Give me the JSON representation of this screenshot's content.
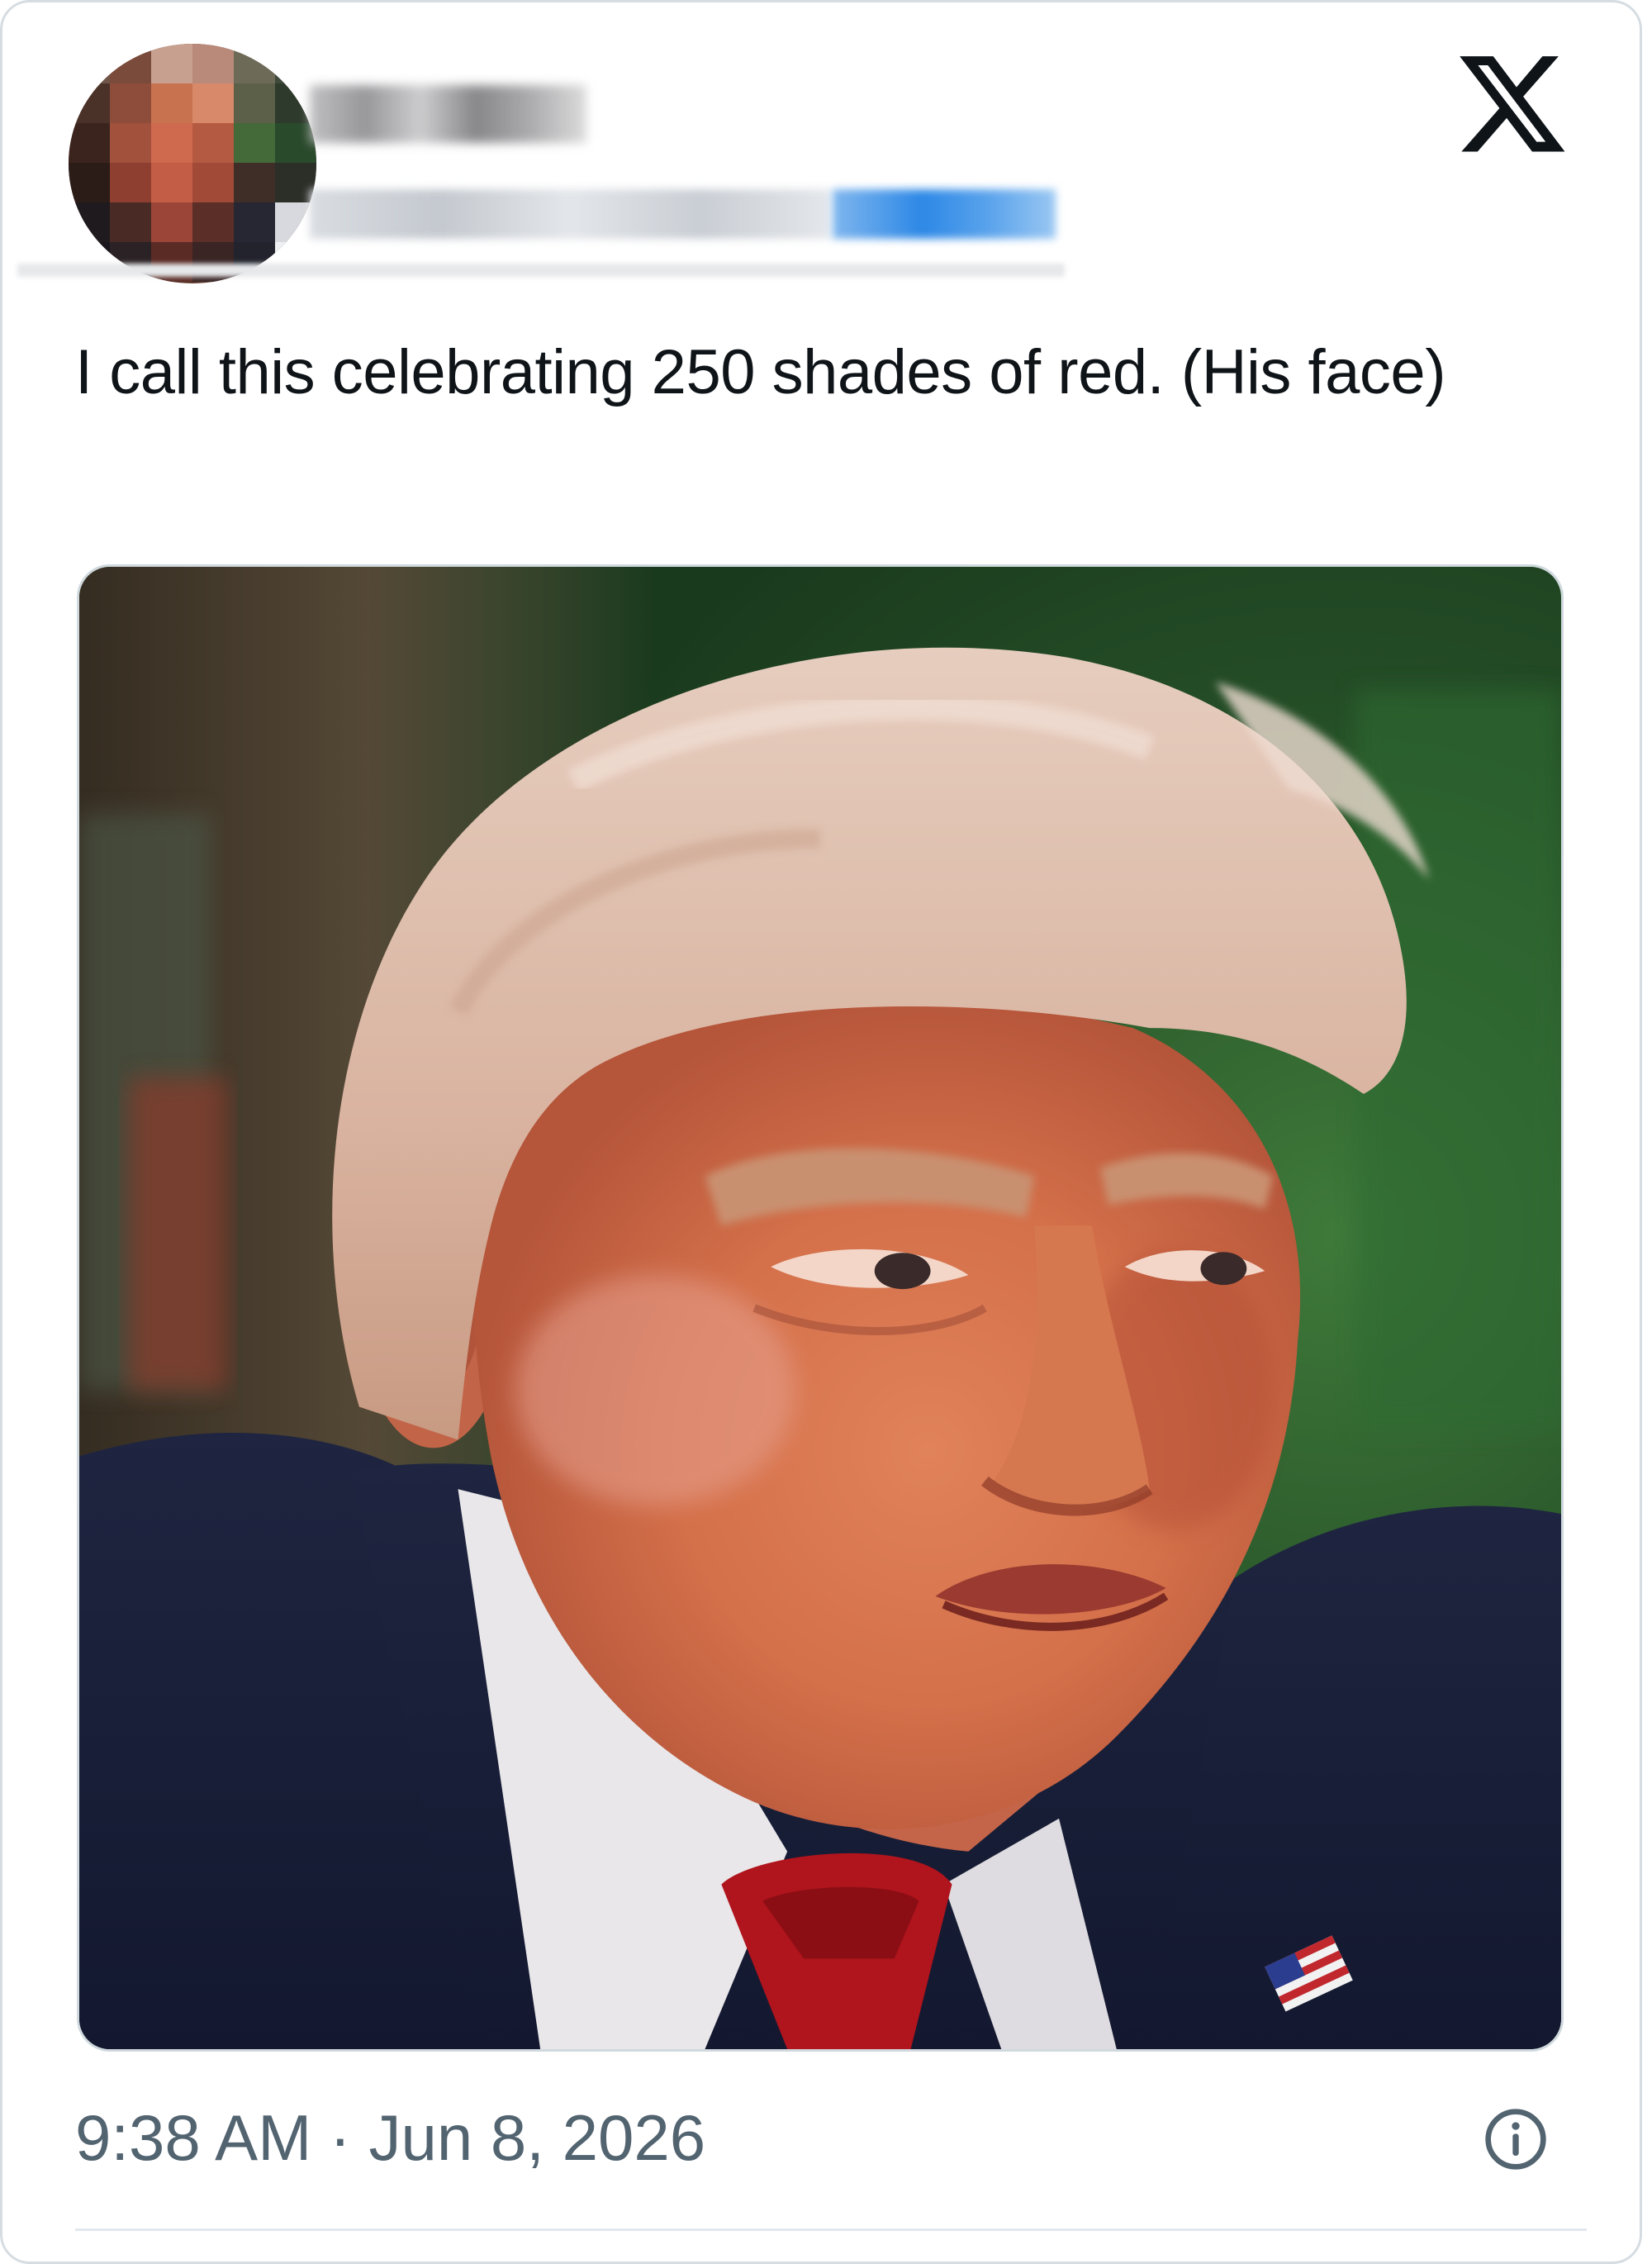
{
  "post": {
    "text": "I call this celebrating 250 shades of red. (His face)",
    "timestamp": "9:38 AM · Jun 8, 2026"
  },
  "header": {
    "brand_icon": "x-logo-icon",
    "author_name_blurred": true,
    "author_handle_blurred": true
  },
  "footer": {
    "info_icon": "info-icon"
  },
  "colors": {
    "text_primary": "#0f1419",
    "text_secondary": "#536471",
    "border": "#cfd9de",
    "link_blue": "#1d9bf0"
  }
}
